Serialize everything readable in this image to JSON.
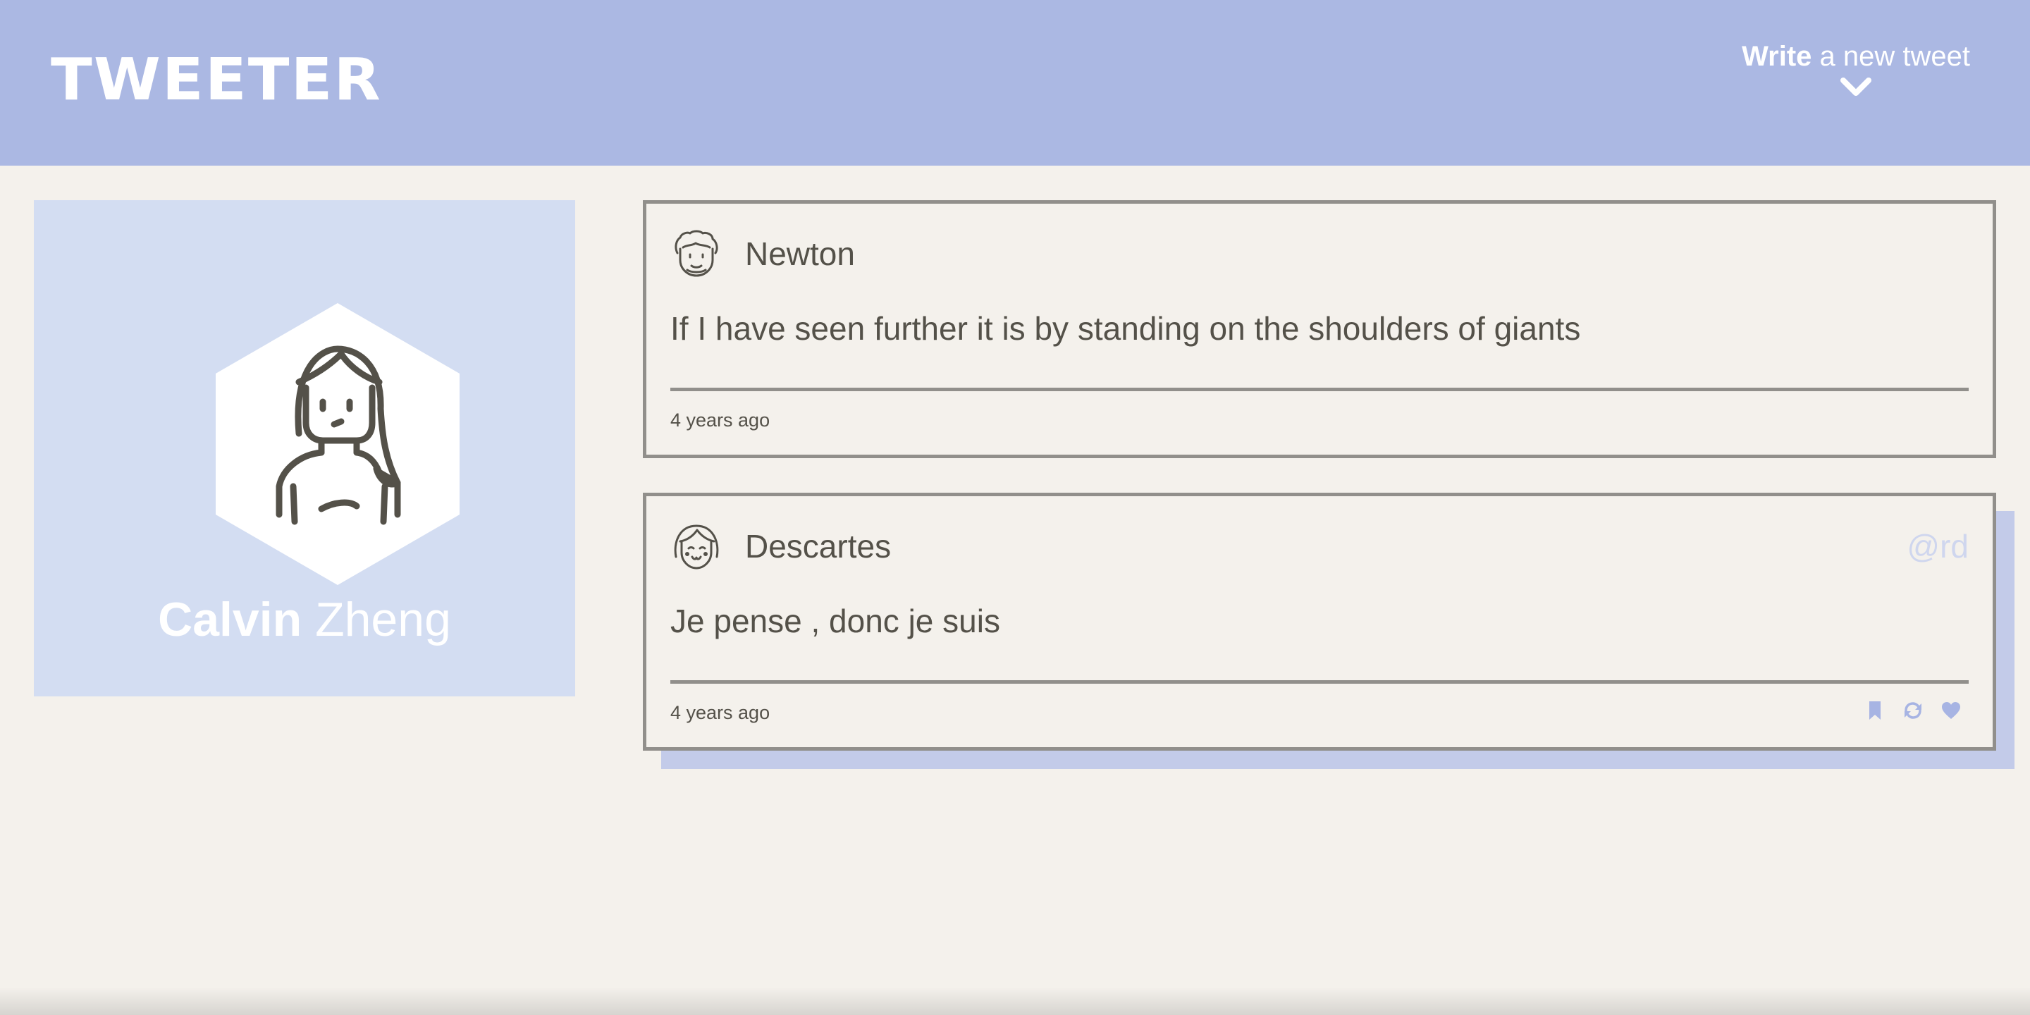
{
  "app": {
    "brand": "TWEETER"
  },
  "header": {
    "compose_strong": "Write",
    "compose_light": " a new tweet",
    "compose_icon": "chevron-down-icon"
  },
  "profile": {
    "first_name": "Calvin",
    "last_name": " Zheng",
    "avatar_icon": "woman-avatar-icon"
  },
  "tweets": [
    {
      "author": "Newton",
      "handle": "",
      "avatar_icon": "curly-hair-man-avatar-icon",
      "content": "If I have seen further it is by standing on the shoulders of giants",
      "time": "4 years ago",
      "show_actions": false
    },
    {
      "author": "Descartes",
      "handle": "@rd",
      "avatar_icon": "bob-hair-avatar-icon",
      "content": "Je pense , donc je suis",
      "time": "4 years ago",
      "show_actions": true,
      "actions": [
        "bookmark-icon",
        "retweet-icon",
        "heart-icon"
      ]
    }
  ],
  "colors": {
    "header_bg": "#abb8e3",
    "page_bg": "#f4f1ec",
    "profile_bg": "#d3ddf2",
    "accent": "#a7b4e3",
    "text": "#545149",
    "border": "#918f8b",
    "hover_shadow": "#c3cbe9"
  }
}
